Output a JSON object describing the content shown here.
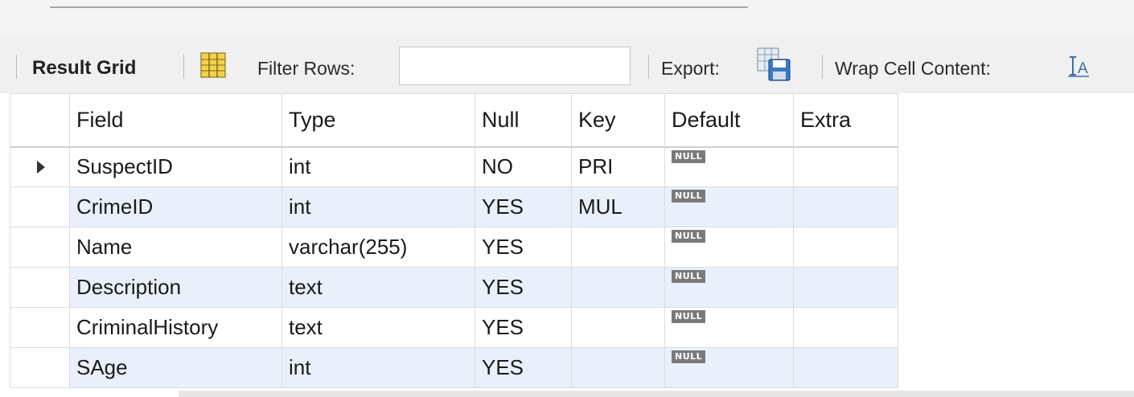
{
  "toolbar": {
    "result_grid_label": "Result Grid",
    "filter_label": "Filter Rows:",
    "filter_value": "",
    "export_label": "Export:",
    "wrap_label": "Wrap Cell Content:"
  },
  "grid": {
    "columns": [
      "Field",
      "Type",
      "Null",
      "Key",
      "Default",
      "Extra"
    ],
    "null_badge": "NULL",
    "rows": [
      {
        "field": "SuspectID",
        "type": "int",
        "null": "NO",
        "key": "PRI",
        "default": "NULL",
        "extra": ""
      },
      {
        "field": "CrimeID",
        "type": "int",
        "null": "YES",
        "key": "MUL",
        "default": "NULL",
        "extra": ""
      },
      {
        "field": "Name",
        "type": "varchar(255)",
        "null": "YES",
        "key": "",
        "default": "NULL",
        "extra": ""
      },
      {
        "field": "Description",
        "type": "text",
        "null": "YES",
        "key": "",
        "default": "NULL",
        "extra": ""
      },
      {
        "field": "CriminalHistory",
        "type": "text",
        "null": "YES",
        "key": "",
        "default": "NULL",
        "extra": ""
      },
      {
        "field": "SAge",
        "type": "int",
        "null": "YES",
        "key": "",
        "default": "NULL",
        "extra": ""
      }
    ]
  },
  "icons": {
    "grid_view": "grid-view-icon",
    "export": "export-save-icon",
    "wrap": "wrap-text-icon",
    "row_pointer": "current-row-arrow-icon"
  },
  "colors": {
    "alt_row": "#e9f0fb",
    "null_badge_bg": "#7a7a7a",
    "toolbar_bg": "#f0f0f0"
  }
}
